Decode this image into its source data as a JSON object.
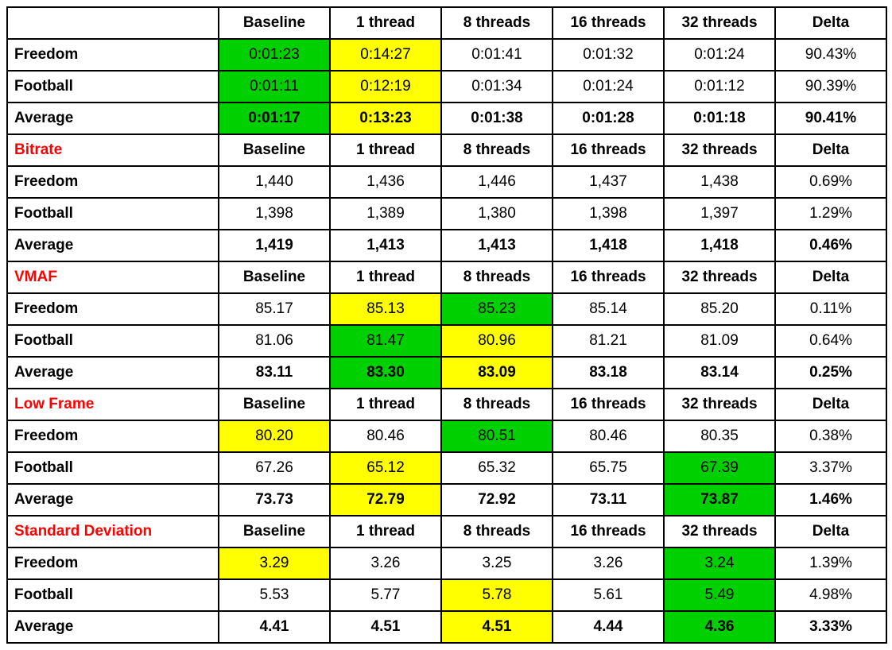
{
  "columns": [
    "Baseline",
    "1 thread",
    "8 threads",
    "16 threads",
    "32 threads",
    "Delta"
  ],
  "row_labels": [
    "Freedom",
    "Football",
    "Average"
  ],
  "sections": [
    {
      "name": "",
      "rows": [
        {
          "label": "Freedom",
          "cells": [
            {
              "v": "0:01:23",
              "hl": "green"
            },
            {
              "v": "0:14:27",
              "hl": "yellow"
            },
            {
              "v": "0:01:41"
            },
            {
              "v": "0:01:32"
            },
            {
              "v": "0:01:24"
            },
            {
              "v": "90.43%"
            }
          ]
        },
        {
          "label": "Football",
          "cells": [
            {
              "v": "0:01:11",
              "hl": "green"
            },
            {
              "v": "0:12:19",
              "hl": "yellow"
            },
            {
              "v": "0:01:34"
            },
            {
              "v": "0:01:24"
            },
            {
              "v": "0:01:12"
            },
            {
              "v": "90.39%"
            }
          ]
        },
        {
          "label": "Average",
          "bold": true,
          "cells": [
            {
              "v": "0:01:17",
              "hl": "green"
            },
            {
              "v": "0:13:23",
              "hl": "yellow"
            },
            {
              "v": "0:01:38"
            },
            {
              "v": "0:01:28"
            },
            {
              "v": "0:01:18"
            },
            {
              "v": "90.41%"
            }
          ]
        }
      ]
    },
    {
      "name": "Bitrate",
      "rows": [
        {
          "label": "Freedom",
          "cells": [
            {
              "v": "1,440"
            },
            {
              "v": "1,436"
            },
            {
              "v": "1,446"
            },
            {
              "v": "1,437"
            },
            {
              "v": "1,438"
            },
            {
              "v": "0.69%"
            }
          ]
        },
        {
          "label": "Football",
          "cells": [
            {
              "v": "1,398"
            },
            {
              "v": "1,389"
            },
            {
              "v": "1,380"
            },
            {
              "v": "1,398"
            },
            {
              "v": "1,397"
            },
            {
              "v": "1.29%"
            }
          ]
        },
        {
          "label": "Average",
          "bold": true,
          "cells": [
            {
              "v": "1,419"
            },
            {
              "v": "1,413"
            },
            {
              "v": "1,413"
            },
            {
              "v": "1,418"
            },
            {
              "v": "1,418"
            },
            {
              "v": "0.46%"
            }
          ]
        }
      ]
    },
    {
      "name": "VMAF",
      "rows": [
        {
          "label": "Freedom",
          "cells": [
            {
              "v": "85.17"
            },
            {
              "v": "85.13",
              "hl": "yellow"
            },
            {
              "v": "85.23",
              "hl": "green"
            },
            {
              "v": "85.14"
            },
            {
              "v": "85.20"
            },
            {
              "v": "0.11%"
            }
          ]
        },
        {
          "label": "Football",
          "cells": [
            {
              "v": "81.06"
            },
            {
              "v": "81.47",
              "hl": "green"
            },
            {
              "v": "80.96",
              "hl": "yellow"
            },
            {
              "v": "81.21"
            },
            {
              "v": "81.09"
            },
            {
              "v": "0.64%"
            }
          ]
        },
        {
          "label": "Average",
          "bold": true,
          "cells": [
            {
              "v": "83.11"
            },
            {
              "v": "83.30",
              "hl": "green"
            },
            {
              "v": "83.09",
              "hl": "yellow"
            },
            {
              "v": "83.18"
            },
            {
              "v": "83.14"
            },
            {
              "v": "0.25%"
            }
          ]
        }
      ]
    },
    {
      "name": "Low Frame",
      "rows": [
        {
          "label": "Freedom",
          "cells": [
            {
              "v": "80.20",
              "hl": "yellow"
            },
            {
              "v": "80.46"
            },
            {
              "v": "80.51",
              "hl": "green"
            },
            {
              "v": "80.46"
            },
            {
              "v": "80.35"
            },
            {
              "v": "0.38%"
            }
          ]
        },
        {
          "label": "Football",
          "cells": [
            {
              "v": "67.26"
            },
            {
              "v": "65.12",
              "hl": "yellow"
            },
            {
              "v": "65.32"
            },
            {
              "v": "65.75"
            },
            {
              "v": "67.39",
              "hl": "green"
            },
            {
              "v": "3.37%"
            }
          ]
        },
        {
          "label": "Average",
          "bold": true,
          "cells": [
            {
              "v": "73.73"
            },
            {
              "v": "72.79",
              "hl": "yellow"
            },
            {
              "v": "72.92"
            },
            {
              "v": "73.11"
            },
            {
              "v": "73.87",
              "hl": "green"
            },
            {
              "v": "1.46%"
            }
          ]
        }
      ]
    },
    {
      "name": "Standard Deviation",
      "rows": [
        {
          "label": "Freedom",
          "cells": [
            {
              "v": "3.29",
              "hl": "yellow"
            },
            {
              "v": "3.26"
            },
            {
              "v": "3.25"
            },
            {
              "v": "3.26"
            },
            {
              "v": "3.24",
              "hl": "green"
            },
            {
              "v": "1.39%"
            }
          ]
        },
        {
          "label": "Football",
          "cells": [
            {
              "v": "5.53"
            },
            {
              "v": "5.77"
            },
            {
              "v": "5.78",
              "hl": "yellow"
            },
            {
              "v": "5.61"
            },
            {
              "v": "5.49",
              "hl": "green"
            },
            {
              "v": "4.98%"
            }
          ]
        },
        {
          "label": "Average",
          "bold": true,
          "cells": [
            {
              "v": "4.41"
            },
            {
              "v": "4.51"
            },
            {
              "v": "4.51",
              "hl": "yellow"
            },
            {
              "v": "4.44"
            },
            {
              "v": "4.36",
              "hl": "green"
            },
            {
              "v": "3.33%"
            }
          ]
        }
      ]
    }
  ]
}
